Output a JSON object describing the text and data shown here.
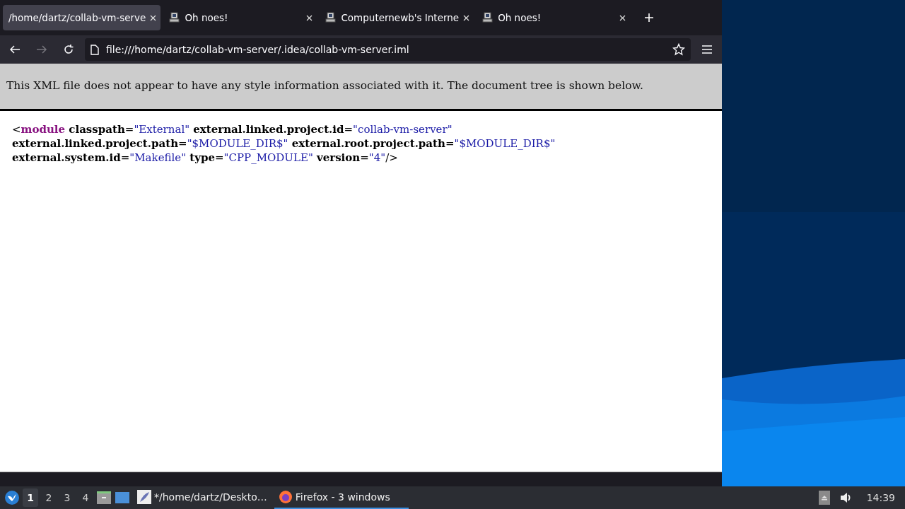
{
  "tabs": [
    {
      "label": "/home/dartz/collab-vm-serve",
      "icon": false,
      "selected": true
    },
    {
      "label": "Oh noes!",
      "icon": true,
      "selected": false
    },
    {
      "label": "Computernewb's Interne",
      "icon": true,
      "selected": false
    },
    {
      "label": "Oh noes!",
      "icon": true,
      "selected": false
    }
  ],
  "nav": {
    "back_disabled": false,
    "forward_disabled": true,
    "url": "file:///home/dartz/collab-vm-server/.idea/collab-vm-server.iml"
  },
  "notice": "This XML file does not appear to have any style information associated with it. The document tree is shown below.",
  "xml_lines": [
    [
      {
        "kind": "punct",
        "text": "<"
      },
      {
        "kind": "tag",
        "text": "module"
      },
      {
        "kind": "attr",
        "text": " classpath"
      },
      {
        "kind": "punct",
        "text": "="
      },
      {
        "kind": "value",
        "text": "\"External\""
      },
      {
        "kind": "attr",
        "text": " external.linked.project.id"
      },
      {
        "kind": "punct",
        "text": "="
      },
      {
        "kind": "value",
        "text": "\"collab-vm-server\""
      }
    ],
    [
      {
        "kind": "attr",
        "text": "external.linked.project.path"
      },
      {
        "kind": "punct",
        "text": "="
      },
      {
        "kind": "value",
        "text": "\"$MODULE_DIR$\""
      },
      {
        "kind": "attr",
        "text": " external.root.project.path"
      },
      {
        "kind": "punct",
        "text": "="
      },
      {
        "kind": "value",
        "text": "\"$MODULE_DIR$\""
      }
    ],
    [
      {
        "kind": "attr",
        "text": "external.system.id"
      },
      {
        "kind": "punct",
        "text": "="
      },
      {
        "kind": "value",
        "text": "\"Makefile\""
      },
      {
        "kind": "attr",
        "text": " type"
      },
      {
        "kind": "punct",
        "text": "="
      },
      {
        "kind": "value",
        "text": "\"CPP_MODULE\""
      },
      {
        "kind": "attr",
        "text": " version"
      },
      {
        "kind": "punct",
        "text": "="
      },
      {
        "kind": "value",
        "text": "\"4\""
      },
      {
        "kind": "punct",
        "text": "/>"
      }
    ]
  ],
  "taskbar": {
    "workspaces": [
      {
        "label": "1",
        "selected": true
      },
      {
        "label": "2",
        "selected": false
      },
      {
        "label": "3",
        "selected": false
      },
      {
        "label": "4",
        "selected": false
      }
    ],
    "tasks": [
      {
        "kind": "editor",
        "label": "*/home/dartz/Deskto…",
        "selected": false
      },
      {
        "kind": "firefox",
        "label": "Firefox - 3 windows",
        "selected": true
      }
    ],
    "clock": "14:39"
  }
}
